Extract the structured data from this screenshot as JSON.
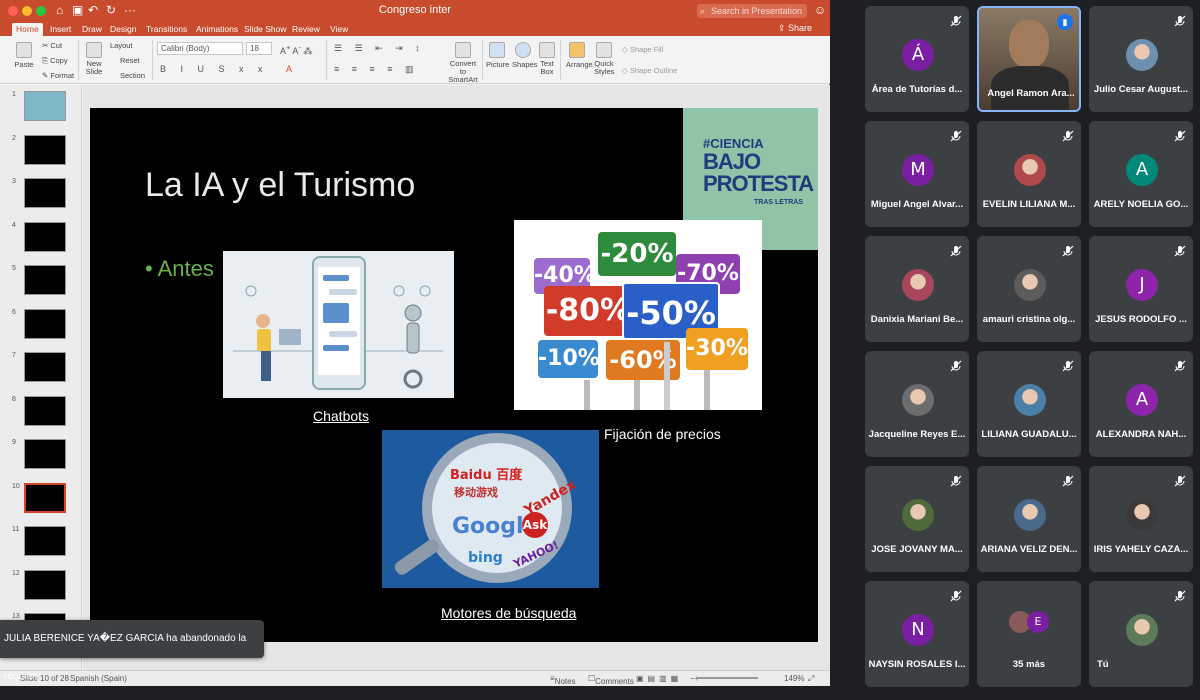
{
  "window": {
    "title": "Congreso inter",
    "search_placeholder": "Search in Presentation",
    "share_label": "Share"
  },
  "ribbon": {
    "tabs": [
      "Home",
      "Insert",
      "Draw",
      "Design",
      "Transitions",
      "Animations",
      "Slide Show",
      "Review",
      "View"
    ],
    "paste": "Paste",
    "cut": "Cut",
    "copy": "Copy",
    "format": "Format",
    "new_slide": "New Slide",
    "layout": "Layout",
    "reset": "Reset",
    "section": "Section",
    "font_name": "Calibri (Body)",
    "font_size": "18",
    "convert": "Convert to SmartArt",
    "picture": "Picture",
    "shapes": "Shapes",
    "text_box": "Text Box",
    "arrange": "Arrange",
    "quick_styles": "Quick Styles",
    "shape_fill": "Shape Fill",
    "shape_outline": "Shape Outline"
  },
  "thumbnails": [
    "1",
    "2",
    "3",
    "4",
    "5",
    "6",
    "7",
    "8",
    "9",
    "10",
    "11",
    "12",
    "13"
  ],
  "slide": {
    "title": "La IA y el Turismo",
    "bullet": "• Antes",
    "logo": {
      "line1": "#CIENCIA",
      "line2": "BAJO",
      "line3": "PROTESTA",
      "line4": "TRAS LETRAS"
    },
    "captions": {
      "chatbots": "Chatbots",
      "precios": "Fijación de precios",
      "motores": "Motores de búsqueda"
    },
    "price_signs": [
      "-20%",
      "-40%",
      "-70%",
      "-80%",
      "-50%",
      "-10%",
      "-60%",
      "-30%"
    ],
    "search_brands": [
      "Baidu 百度",
      "移动游戏",
      "Yandex",
      "Google",
      "Ask",
      "bing",
      "YAHOO!"
    ]
  },
  "status_bar": {
    "slide_info": "Slide 10 of 28",
    "language": "Spanish (Spain)",
    "notes": "Notes",
    "comments": "Comments",
    "zoom": "149%"
  },
  "toast": "JULIA BERENICE YA�EZ GARCIA ha abandonado la reunión",
  "participants": [
    {
      "name": "Área de Tutorías d...",
      "initial": "Á",
      "color": "#7b1fa2",
      "muted": true
    },
    {
      "name": "Angel Ramon Ara...",
      "initial": "",
      "color": "#5a4a3a",
      "muted": false,
      "speaking": true
    },
    {
      "name": "Julio Cesar August...",
      "initial": "",
      "color": "#6d8fb0",
      "muted": true
    },
    {
      "name": "Miguel Angel Alvar...",
      "initial": "M",
      "color": "#7b1fa2",
      "muted": true
    },
    {
      "name": "EVELIN LILIANA M...",
      "initial": "",
      "color": "#b04a4a",
      "muted": true
    },
    {
      "name": "ARELY NOELIA GO...",
      "initial": "A",
      "color": "#00897b",
      "muted": true
    },
    {
      "name": "Danixia Mariani Be...",
      "initial": "",
      "color": "#a8475c",
      "muted": true
    },
    {
      "name": "amauri cristina olg...",
      "initial": "",
      "color": "#5c5c5c",
      "muted": true
    },
    {
      "name": "JESUS RODOLFO ...",
      "initial": "J",
      "color": "#8e24aa",
      "muted": true
    },
    {
      "name": "Jacqueline Reyes E...",
      "initial": "",
      "color": "#6d6d6d",
      "muted": true
    },
    {
      "name": "LILIANA GUADALU...",
      "initial": "",
      "color": "#4a7fa8",
      "muted": true
    },
    {
      "name": "ALEXANDRA NAH...",
      "initial": "A",
      "color": "#8e24aa",
      "muted": true
    },
    {
      "name": "JOSE JOVANY MA...",
      "initial": "",
      "color": "#4f6b3a",
      "muted": true
    },
    {
      "name": "ARIANA VELIZ DEN...",
      "initial": "",
      "color": "#4a6a8a",
      "muted": true
    },
    {
      "name": "IRIS YAHELY CAZA...",
      "initial": "",
      "color": "#3a3a3a",
      "muted": true
    },
    {
      "name": "NAYSIN ROSALES I...",
      "initial": "N",
      "color": "#7b1fa2",
      "muted": true
    },
    {
      "name": "35 más",
      "initial": "E",
      "color": "#7b1fa2",
      "muted": false
    },
    {
      "name": "Tú",
      "initial": "",
      "color": "#5d7a5a",
      "muted": true
    }
  ]
}
